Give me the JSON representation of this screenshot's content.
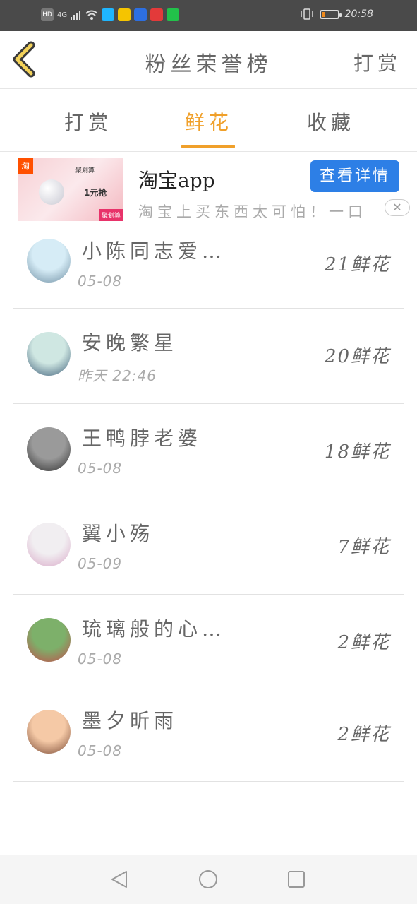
{
  "status_bar": {
    "network_badges": [
      "HD",
      "4G"
    ],
    "app_icons": [
      {
        "name": "video-app-icon",
        "color": "#1fb6ff"
      },
      {
        "name": "game-app-icon",
        "color": "#f5c400"
      },
      {
        "name": "baidu-app-icon",
        "color": "#2d6fe0"
      },
      {
        "name": "weibo-app-icon",
        "color": "#e33a3a"
      },
      {
        "name": "iqiyi-app-icon",
        "color": "#22c24a"
      }
    ],
    "battery_level": 0.2,
    "time": "20:58"
  },
  "header": {
    "title": "粉丝荣誉榜",
    "action": "打赏"
  },
  "tabs": [
    {
      "label": "打赏",
      "active": false
    },
    {
      "label": "鲜花",
      "active": true
    },
    {
      "label": "收藏",
      "active": false
    }
  ],
  "ad": {
    "badge": "淘",
    "image_tag": "聚划算",
    "image_price": "1元抢",
    "image_brand": "聚划算",
    "title": "淘宝app",
    "button": "查看详情",
    "description": "淘宝上买东西太可怕！一口",
    "close": "✕"
  },
  "fans": [
    {
      "name": "小陈同志爱…",
      "date": "05-08",
      "count": "21鲜花",
      "avatar_colors": [
        "#d6ecf6",
        "#6f8fa3"
      ]
    },
    {
      "name": "安晚繁星",
      "date": "昨天 22:46",
      "count": "20鲜花",
      "avatar_colors": [
        "#cfe7e2",
        "#3f5f7a"
      ]
    },
    {
      "name": "王鸭脖老婆",
      "date": "05-08",
      "count": "18鲜花",
      "avatar_colors": [
        "#9a9a9a",
        "#2e2e2e"
      ]
    },
    {
      "name": "翼小殇",
      "date": "05-09",
      "count": "7鲜花",
      "avatar_colors": [
        "#f1eef1",
        "#d9a9c8"
      ]
    },
    {
      "name": "琉璃般的心…",
      "date": "05-08",
      "count": "2鲜花",
      "avatar_colors": [
        "#7db06a",
        "#c44b4b"
      ]
    },
    {
      "name": "墨夕昕雨",
      "date": "05-08",
      "count": "2鲜花",
      "avatar_colors": [
        "#f5c9a6",
        "#7a4a35"
      ]
    }
  ]
}
